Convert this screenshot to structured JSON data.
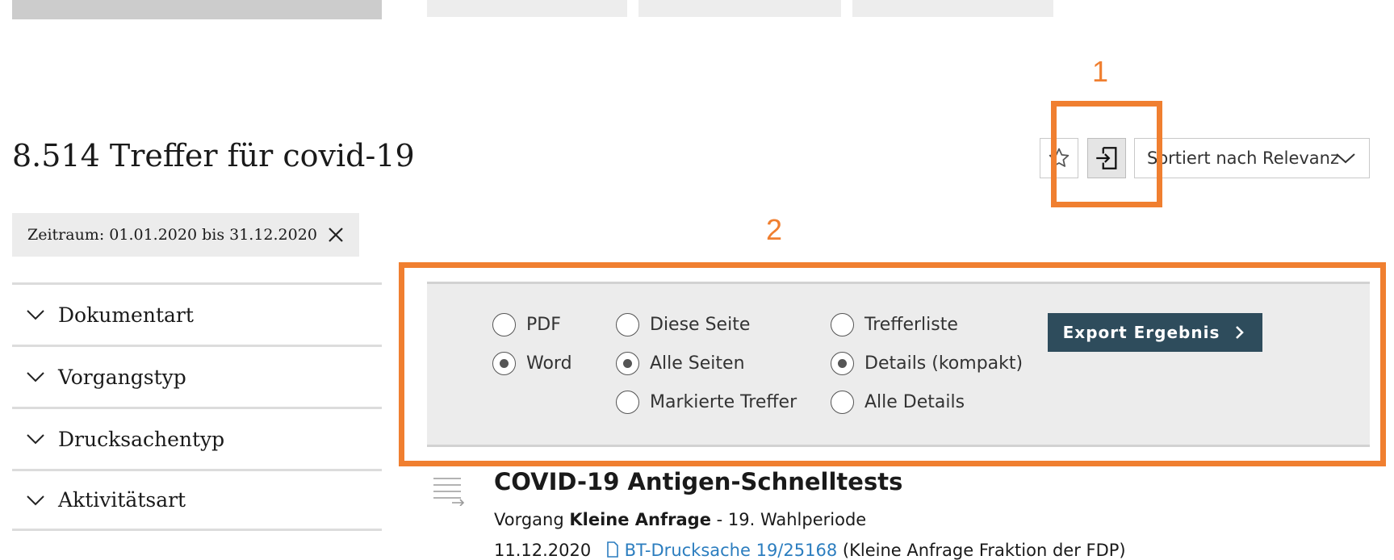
{
  "results": {
    "title": "8.514 Treffer für covid-19"
  },
  "toolbar": {
    "sort_label": "Sortiert nach Relevanz"
  },
  "filters": {
    "active_chip": "Zeitraum: 01.01.2020 bis 31.12.2020"
  },
  "facets": [
    {
      "label": "Dokumentart"
    },
    {
      "label": "Vorgangstyp"
    },
    {
      "label": "Drucksachentyp"
    },
    {
      "label": "Aktivitätsart"
    }
  ],
  "export": {
    "format_options": [
      {
        "label": "PDF",
        "selected": false
      },
      {
        "label": "Word",
        "selected": true
      }
    ],
    "range_options": [
      {
        "label": "Diese Seite",
        "selected": false
      },
      {
        "label": "Alle Seiten",
        "selected": true
      },
      {
        "label": "Markierte Treffer",
        "selected": false
      }
    ],
    "detail_options": [
      {
        "label": "Trefferliste",
        "selected": false
      },
      {
        "label": "Details (kompakt)",
        "selected": true
      },
      {
        "label": "Alle Details",
        "selected": false
      }
    ],
    "button_label": "Export Ergebnis"
  },
  "annotations": {
    "marker_1": "1",
    "marker_2": "2"
  },
  "result": {
    "title": "COVID-19 Antigen-Schnelltests",
    "meta_prefix": "Vorgang",
    "meta_type": "Kleine Anfrage",
    "meta_suffix": " - 19. Wahlperiode",
    "date": "11.12.2020",
    "doc_link": "BT-Drucksache 19/25168",
    "doc_note": "(Kleine Anfrage Fraktion der FDP)"
  },
  "colors": {
    "accent_annotation": "#f07f30",
    "export_button": "#2e4c5c",
    "link": "#2b7dbf"
  },
  "icons": [
    "star-icon",
    "export-icon",
    "chevron-down-icon",
    "close-icon",
    "chevron-right-icon",
    "list-icon",
    "document-icon"
  ]
}
